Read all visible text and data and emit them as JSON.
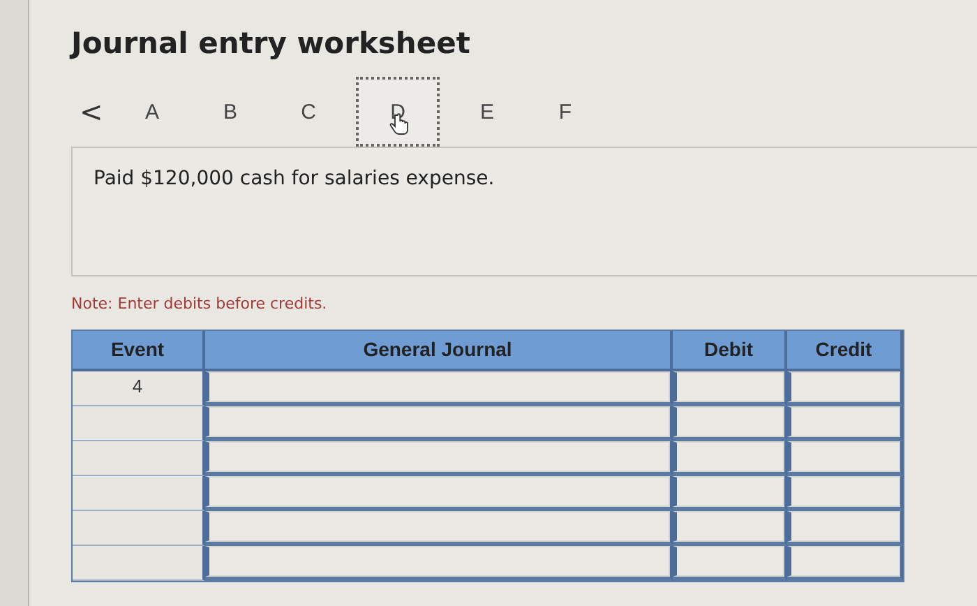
{
  "title": "Journal entry worksheet",
  "nav": {
    "prev": "<",
    "tabs": [
      {
        "label": "A",
        "selected": false
      },
      {
        "label": "B",
        "selected": false
      },
      {
        "label": "C",
        "selected": false
      },
      {
        "label": "D",
        "selected": true
      },
      {
        "label": "E",
        "selected": false
      },
      {
        "label": "F",
        "selected": false
      }
    ]
  },
  "description": "Paid $120,000 cash for salaries expense.",
  "note": "Note: Enter debits before credits.",
  "table": {
    "columns": [
      "Event",
      "General Journal",
      "Debit",
      "Credit"
    ],
    "rows": [
      {
        "event": "4"
      },
      {},
      {},
      {},
      {},
      {}
    ]
  }
}
